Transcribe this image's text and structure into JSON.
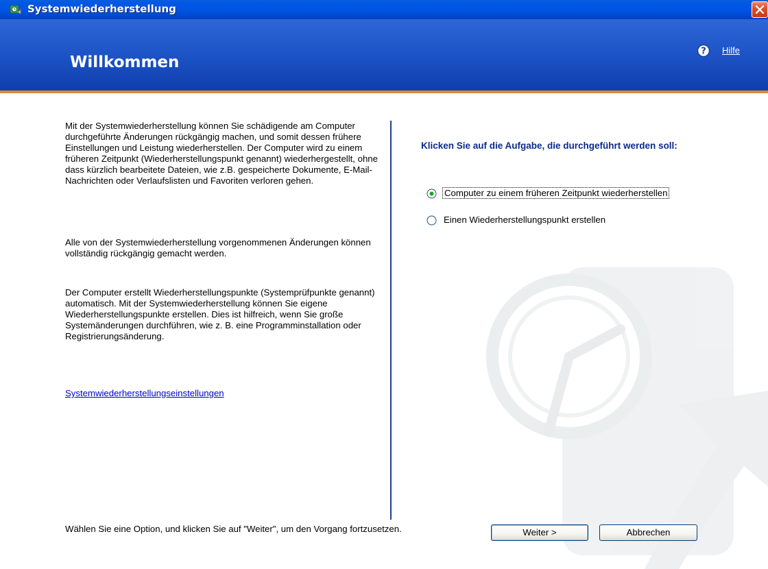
{
  "window": {
    "title": "Systemwiederherstellung",
    "close_icon": "close-icon"
  },
  "header": {
    "title": "Willkommen",
    "help_icon": "help-question-icon",
    "help_label": "Hilfe"
  },
  "left_panel": {
    "paragraph1": "Mit der Systemwiederherstellung können Sie schädigende am Computer durchgeführte Änderungen rückgängig machen, und somit dessen frühere Einstellungen und Leistung wiederherstellen. Der Computer wird zu einem früheren Zeitpunkt (Wiederherstellungspunkt genannt) wiederhergestellt, ohne dass kürzlich bearbeitete Dateien, wie z.B. gespeicherte Dokumente, E-Mail-Nachrichten oder Verlaufslisten und Favoriten verloren gehen.",
    "paragraph2": "Alle von der Systemwiederherstellung vorgenommenen Änderungen können vollständig rückgängig gemacht werden.",
    "paragraph3": "Der Computer erstellt Wiederherstellungspunkte (Systemprüfpunkte genannt) automatisch. Mit der Systemwiederherstellung können Sie eigene Wiederherstellungspunkte erstellen. Dies ist hilfreich, wenn Sie große Systemänderungen durchführen, wie z. B. eine Programminstallation oder Registrierungsänderung.",
    "settings_link": "Systemwiederherstellungseinstellungen",
    "instruction": "Wählen Sie eine Option, und klicken Sie auf \"Weiter\", um den Vorgang fortzusetzen."
  },
  "right_panel": {
    "task_heading": "Klicken Sie auf die Aufgabe, die durchgeführt werden soll:",
    "options": [
      {
        "label": "Computer zu einem früheren Zeitpunkt wiederherstellen",
        "selected": true
      },
      {
        "label": "Einen Wiederherstellungspunkt erstellen",
        "selected": false
      }
    ]
  },
  "buttons": {
    "next": "Weiter >",
    "cancel": "Abbrechen"
  },
  "colors": {
    "titlebar": "#0054e3",
    "header": "#1e55c8",
    "header_accent": "#e0882f",
    "heading_text": "#0a2a8a",
    "link": "#0000cc"
  }
}
